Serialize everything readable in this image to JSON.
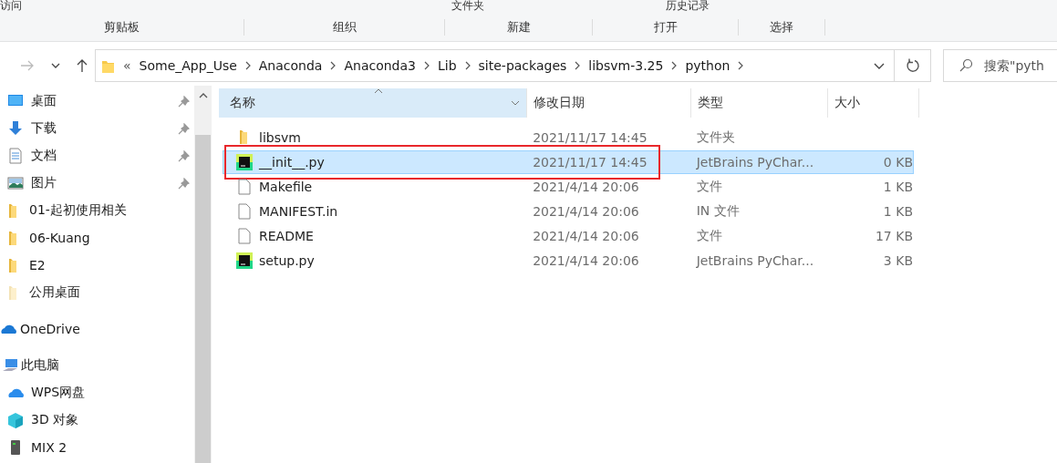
{
  "ribbon": {
    "top_texts": [
      "访问",
      "文件夹",
      "历史记录"
    ],
    "groups": [
      "剪贴板",
      "组织",
      "新建",
      "打开",
      "选择"
    ]
  },
  "address": {
    "overflow": "«",
    "segments": [
      "Some_App_Use",
      "Anaconda",
      "Anaconda3",
      "Lib",
      "site-packages",
      "libsvm-3.25",
      "python"
    ],
    "search_placeholder": "搜索\"pyth"
  },
  "sidebar": {
    "items": [
      {
        "kind": "desktop",
        "label": "桌面",
        "pinned": true
      },
      {
        "kind": "download",
        "label": "下载",
        "pinned": true
      },
      {
        "kind": "document",
        "label": "文档",
        "pinned": true
      },
      {
        "kind": "picture",
        "label": "图片",
        "pinned": true
      },
      {
        "kind": "folder",
        "label": "01-起初使用相关",
        "pinned": false
      },
      {
        "kind": "folder",
        "label": "06-Kuang",
        "pinned": false
      },
      {
        "kind": "folder",
        "label": "E2",
        "pinned": false
      },
      {
        "kind": "folder_light",
        "label": "公用桌面",
        "pinned": false
      },
      {
        "kind": "onedrive",
        "label": "OneDrive",
        "pinned": false
      },
      {
        "kind": "pc",
        "label": "此电脑",
        "pinned": false
      },
      {
        "kind": "cloud",
        "label": "WPS网盘",
        "pinned": false
      },
      {
        "kind": "cube",
        "label": "3D 对象",
        "pinned": false
      },
      {
        "kind": "drive",
        "label": "MIX 2",
        "pinned": false
      }
    ]
  },
  "table": {
    "columns": [
      {
        "label": "名称",
        "sorted": true
      },
      {
        "label": "修改日期",
        "sorted": false
      },
      {
        "label": "类型",
        "sorted": false
      },
      {
        "label": "大小",
        "sorted": false
      }
    ],
    "rows": [
      {
        "kind": "folder",
        "name": "libsvm",
        "date": "2021/11/17 14:45",
        "type": "文件夹",
        "size": "",
        "selected": false,
        "highlighted": false
      },
      {
        "kind": "pycharm",
        "name": "__init__.py",
        "date": "2021/11/17 14:45",
        "type": "JetBrains PyChar...",
        "size": "0 KB",
        "selected": true,
        "highlighted": true
      },
      {
        "kind": "file",
        "name": "Makefile",
        "date": "2021/4/14 20:06",
        "type": "文件",
        "size": "1 KB",
        "selected": false,
        "highlighted": false
      },
      {
        "kind": "file",
        "name": "MANIFEST.in",
        "date": "2021/4/14 20:06",
        "type": "IN 文件",
        "size": "1 KB",
        "selected": false,
        "highlighted": false
      },
      {
        "kind": "file",
        "name": "README",
        "date": "2021/4/14 20:06",
        "type": "文件",
        "size": "17 KB",
        "selected": false,
        "highlighted": false
      },
      {
        "kind": "pycharm",
        "name": "setup.py",
        "date": "2021/4/14 20:06",
        "type": "JetBrains PyChar...",
        "size": "3 KB",
        "selected": false,
        "highlighted": false
      }
    ]
  }
}
